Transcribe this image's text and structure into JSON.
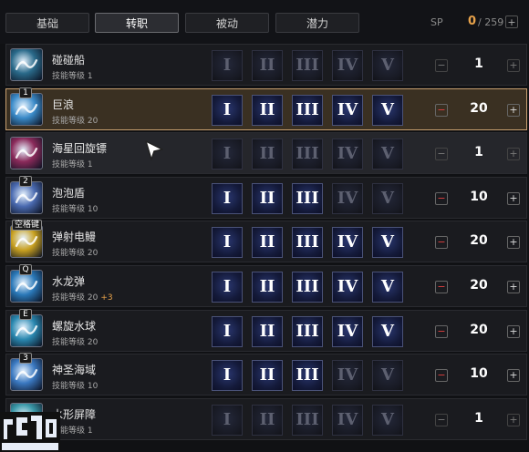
{
  "tabs": [
    {
      "label": "基础",
      "active": false
    },
    {
      "label": "转职",
      "active": true
    },
    {
      "label": "被动",
      "active": false
    },
    {
      "label": "潜力",
      "active": false
    }
  ],
  "sp": {
    "label": "SP",
    "value": "0",
    "total": "/ 259",
    "button": "+"
  },
  "tier_labels": [
    "I",
    "II",
    "III",
    "IV",
    "V"
  ],
  "skills": [
    {
      "name": "碰碰船",
      "level_text": "技能等级 1",
      "bonus": "",
      "key": "",
      "count": "1",
      "tiers_lit": 0,
      "minus_on": false,
      "plus_on": false,
      "icon": "boat-icon",
      "color": "#2a6a8a",
      "minus": "−",
      "plus": "+"
    },
    {
      "name": "巨浪",
      "level_text": "技能等级 20",
      "bonus": "",
      "key": "1",
      "count": "20",
      "tiers_lit": 5,
      "minus_on": true,
      "plus_on": true,
      "icon": "wave-icon",
      "color": "#3a8ac8",
      "minus": "−",
      "plus": "+"
    },
    {
      "name": "海星回旋镖",
      "level_text": "技能等级 1",
      "bonus": "",
      "key": "",
      "count": "1",
      "tiers_lit": 0,
      "minus_on": false,
      "plus_on": false,
      "icon": "starfish-icon",
      "color": "#8a2a5a",
      "minus": "−",
      "plus": "+"
    },
    {
      "name": "泡泡盾",
      "level_text": "技能等级 10",
      "bonus": "",
      "key": "2",
      "count": "10",
      "tiers_lit": 3,
      "minus_on": true,
      "plus_on": true,
      "icon": "bubble-shield-icon",
      "color": "#4a6ab0",
      "minus": "−",
      "plus": "+"
    },
    {
      "name": "弹射电鳗",
      "level_text": "技能等级 20",
      "bonus": "",
      "key": "空格键",
      "count": "20",
      "tiers_lit": 5,
      "minus_on": true,
      "plus_on": true,
      "icon": "eel-icon",
      "color": "#c8a020",
      "minus": "−",
      "plus": "+"
    },
    {
      "name": "水龙弹",
      "level_text": "技能等级 20",
      "bonus": "+3",
      "key": "Q",
      "count": "20",
      "tiers_lit": 5,
      "minus_on": true,
      "plus_on": true,
      "icon": "water-dragon-icon",
      "color": "#2a78b8",
      "minus": "−",
      "plus": "+"
    },
    {
      "name": "螺旋水球",
      "level_text": "技能等级 20",
      "bonus": "",
      "key": "E",
      "count": "20",
      "tiers_lit": 5,
      "minus_on": true,
      "plus_on": true,
      "icon": "spiral-orb-icon",
      "color": "#2a88b0",
      "minus": "−",
      "plus": "+"
    },
    {
      "name": "神圣海域",
      "level_text": "技能等级 10",
      "bonus": "",
      "key": "3",
      "count": "10",
      "tiers_lit": 3,
      "minus_on": true,
      "plus_on": true,
      "icon": "sacred-sea-icon",
      "color": "#3a78c0",
      "minus": "−",
      "plus": "+"
    },
    {
      "name": "水形屏障",
      "level_text": "技能等级 1",
      "bonus": "",
      "key": "",
      "count": "1",
      "tiers_lit": 0,
      "minus_on": false,
      "plus_on": false,
      "icon": "water-barrier-icon",
      "color": "#3a98a8",
      "minus": "−",
      "plus": "+"
    }
  ],
  "selected_index": 1,
  "hover_index": 2
}
